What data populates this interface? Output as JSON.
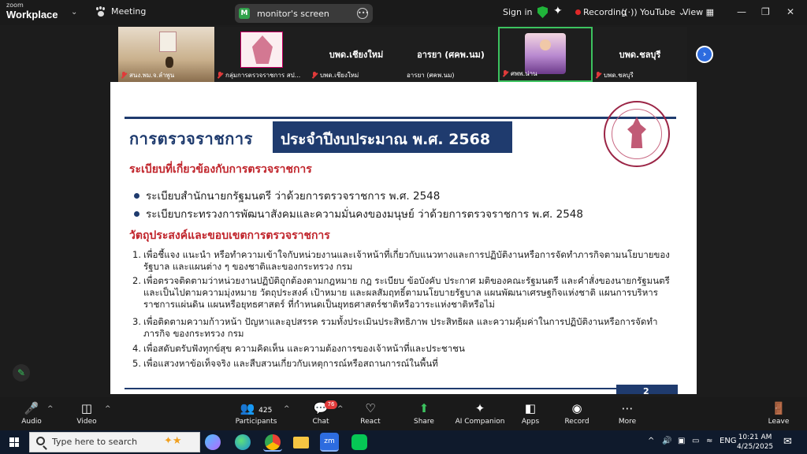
{
  "window": {
    "brand_top": "zoom",
    "brand_name": "Workplace",
    "meeting_label": "Meeting",
    "screen_badge": "M",
    "screen_label": "monitor's screen",
    "sign_in": "Sign in",
    "recording": "Recording",
    "youtube": "YouTube",
    "view": "View",
    "colors": {
      "bg": "#1c1c1c",
      "shield": "#20b43a",
      "record": "#e02828",
      "accent": "#2d6cdf"
    }
  },
  "gallery": {
    "tiles": [
      {
        "name": "สนง.พม.จ.ลำพูน",
        "big": ""
      },
      {
        "name": "กลุ่มการตรวจราชการ สป...",
        "big": ""
      },
      {
        "name": "บพด.เชียงใหม่",
        "big": "บพด.เชียงใหม่"
      },
      {
        "name": "อารยา (ศคพ.นม)",
        "big": "อารยา (ศคพ.นม)"
      },
      {
        "name": "ศพพ.น่าน",
        "big": ""
      },
      {
        "name": "บพด.ชลบุรี",
        "big": "บพด.ชลบุรี"
      }
    ]
  },
  "slide": {
    "heading": "การตรวจราชการ",
    "heading_box": "ประจำปีงบประมาณ พ.ศ. 2568",
    "section1_title": "ระเบียบที่เกี่ยวข้องกับการตรวจราชการ",
    "bullets": [
      "ระเบียบสำนักนายกรัฐมนตรี ว่าด้วยการตรวจราชการ พ.ศ. 2548",
      "ระเบียบกระทรวงการพัฒนาสังคมและความมั่นคงของมนุษย์ ว่าด้วยการตรวจราชการ พ.ศ. 2548"
    ],
    "section2_title": "วัตถุประสงค์และขอบเขตการตรวจราชการ",
    "objectives": [
      {
        "n": "1.",
        "text": "เพื่อชี้แจง แนะนำ หรือทำความเข้าใจกับหน่วยงานและเจ้าหน้าที่เกี่ยวกับแนวทางและการปฏิบัติงานหรือการจัดทำภารกิจตามนโยบายของรัฐบาล และแผนต่าง ๆ ของชาติและของกระทรวง กรม"
      },
      {
        "n": "2.",
        "text": "เพื่อตรวจติดตามว่าหน่วยงานปฏิบัติถูกต้องตามกฎหมาย กฎ ระเบียบ ข้อบังคับ ประกาศ มติของคณะรัฐมนตรี และคำสั่งของนายกรัฐมนตรี และเป็นไปตามความมุ่งหมาย วัตถุประสงค์ เป้าหมาย และผลสัมฤทธิ์ตามนโยบายรัฐบาล แผนพัฒนาเศรษฐกิจแห่งชาติ แผนการบริหารราชการแผ่นดิน แผนหรือยุทธศาสตร์ ที่กำหนดเป็นยุทธศาสตร์ชาติหรือวาระแห่งชาติหรือไม่"
      },
      {
        "n": "3.",
        "text": "เพื่อติดตามความก้าวหน้า ปัญหาและอุปสรรค รวมทั้งประเมินประสิทธิภาพ ประสิทธิผล และความคุ้มค่าในการปฏิบัติงานหรือการจัดทำภารกิจ ของกระทรวง กรม"
      },
      {
        "n": "4.",
        "text": "เพื่อสดับตรับฟังทุกข์สุข ความคิดเห็น และความต้องการของเจ้าหน้าที่และประชาชน"
      },
      {
        "n": "5.",
        "text": "เพื่อแสวงหาข้อเท็จจริง และสืบสวนเกี่ยวกับเหตุการณ์หรือสถานการณ์ในพื้นที่"
      }
    ],
    "page_number": "2",
    "colors": {
      "navy": "#1f3b6e",
      "red": "#c0232a",
      "emblem": "#9b2546"
    }
  },
  "toolbar": {
    "audio": "Audio",
    "video": "Video",
    "participants": "Participants",
    "participants_count": "425",
    "chat": "Chat",
    "chat_badge": "76",
    "react": "React",
    "share": "Share",
    "ai": "AI Companion",
    "apps": "Apps",
    "record": "Record",
    "more": "More",
    "leave": "Leave"
  },
  "taskbar": {
    "search_placeholder": "Type here to search",
    "lang": "ENG",
    "time": "10:21 AM",
    "date": "4/25/2025"
  }
}
